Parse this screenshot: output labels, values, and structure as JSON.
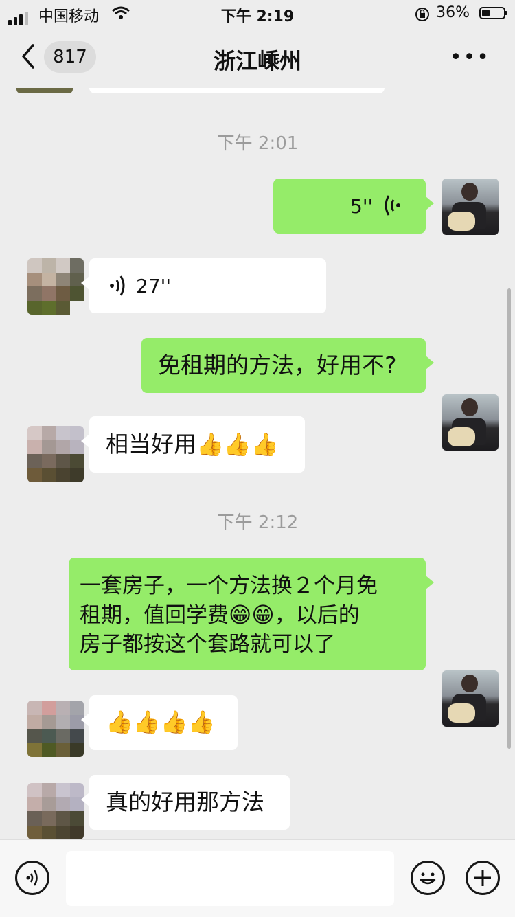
{
  "status_bar": {
    "carrier": "中国移动",
    "time": "下午 2:19",
    "battery": "36%",
    "battery_level": 0.36
  },
  "nav": {
    "unread_count": "817",
    "title": "浙江嵊州",
    "more": "•••"
  },
  "messages": {
    "ts1": "下午 2:01",
    "m1_voice": "5''",
    "m2_voice": "27''",
    "m3": "免租期的方法，好用不?",
    "m4_text": "相当好用",
    "m4_emoji": "👍👍👍",
    "ts2": "下午 2:12",
    "m5_l1a": "一套房子，一个方法换２个月免",
    "m5_l2a": "租期，值回学费",
    "m5_l2_emoji": "😁😁",
    "m5_l2b": "，以后的",
    "m5_l3": "房子都按这个套路就可以了",
    "m6_emoji": "👍👍👍👍",
    "m7": "真的好用那方法"
  },
  "colors": {
    "background": "#ededed",
    "outgoing_bubble": "#95ec69",
    "incoming_bubble": "#ffffff",
    "timestamp": "#9b9b9b"
  },
  "icons": [
    "back-chevron-icon",
    "more-dots-icon",
    "voice-wave-icon",
    "voice-mode-icon",
    "emoji-icon",
    "plus-icon",
    "wifi-icon",
    "signal-icon",
    "battery-icon",
    "rotation-lock-icon"
  ]
}
